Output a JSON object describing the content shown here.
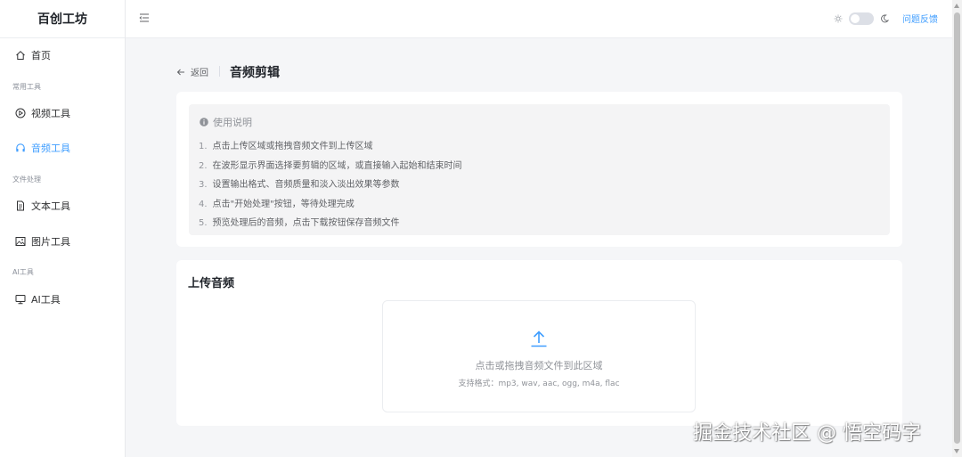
{
  "brand": "百创工坊",
  "sidebar": {
    "home": "首页",
    "group_common": "常用工具",
    "video": "视频工具",
    "audio": "音频工具",
    "group_file": "文件处理",
    "text": "文本工具",
    "image": "图片工具",
    "group_ai": "AI工具",
    "ai": "AI工具"
  },
  "header": {
    "feedback": "问题反馈",
    "dark_mode_on": false
  },
  "page": {
    "back": "返回",
    "title": "音频剪辑"
  },
  "instructions": {
    "title": "使用说明",
    "steps": [
      {
        "num": "1.",
        "text": "点击上传区域或拖拽音频文件到上传区域"
      },
      {
        "num": "2.",
        "text": "在波形显示界面选择要剪辑的区域，或直接输入起始和结束时间"
      },
      {
        "num": "3.",
        "text": "设置输出格式、音频质量和淡入淡出效果等参数"
      },
      {
        "num": "4.",
        "text": "点击\"开始处理\"按钮，等待处理完成"
      },
      {
        "num": "5.",
        "text": "预览处理后的音频，点击下载按钮保存音频文件"
      }
    ]
  },
  "upload": {
    "title": "上传音频",
    "drop_text": "点击或拖拽音频文件到此区域",
    "hint": "支持格式：mp3, wav, aac, ogg, m4a, flac"
  },
  "watermark": "掘金技术社区 @ 悟空码字",
  "colors": {
    "accent": "#409eff",
    "page_bg": "#f5f6f8"
  }
}
